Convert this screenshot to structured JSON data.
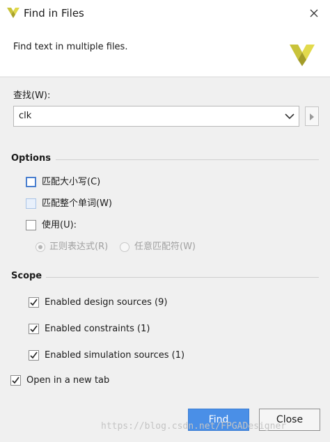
{
  "window": {
    "title": "Find in Files"
  },
  "header": {
    "description": "Find text in multiple files."
  },
  "search": {
    "label": "查找(W):",
    "value": "clk"
  },
  "options": {
    "title": "Options",
    "match_case": {
      "label": "匹配大小写(C)",
      "checked": false
    },
    "whole_word": {
      "label": "匹配整个单词(W)",
      "checked": false
    },
    "use": {
      "label": "使用(U):",
      "checked": false
    },
    "regex": {
      "label": "正则表达式(R)",
      "selected": true,
      "enabled": false
    },
    "wildcard": {
      "label": "任意匹配符(W)",
      "selected": false,
      "enabled": false
    }
  },
  "scope": {
    "title": "Scope",
    "items": [
      {
        "label": "Enabled design sources (9)",
        "checked": true
      },
      {
        "label": "Enabled constraints (1)",
        "checked": true
      },
      {
        "label": "Enabled simulation sources (1)",
        "checked": true
      }
    ]
  },
  "new_tab": {
    "label": "Open in a new tab",
    "checked": true
  },
  "buttons": {
    "find": "Find",
    "close": "Close"
  },
  "watermark": "https://blog.csdn.net/FPGADesigner",
  "colors": {
    "accent": "#4a8fe7",
    "logo": "#c9c33a",
    "background": "#f0f0f0"
  }
}
